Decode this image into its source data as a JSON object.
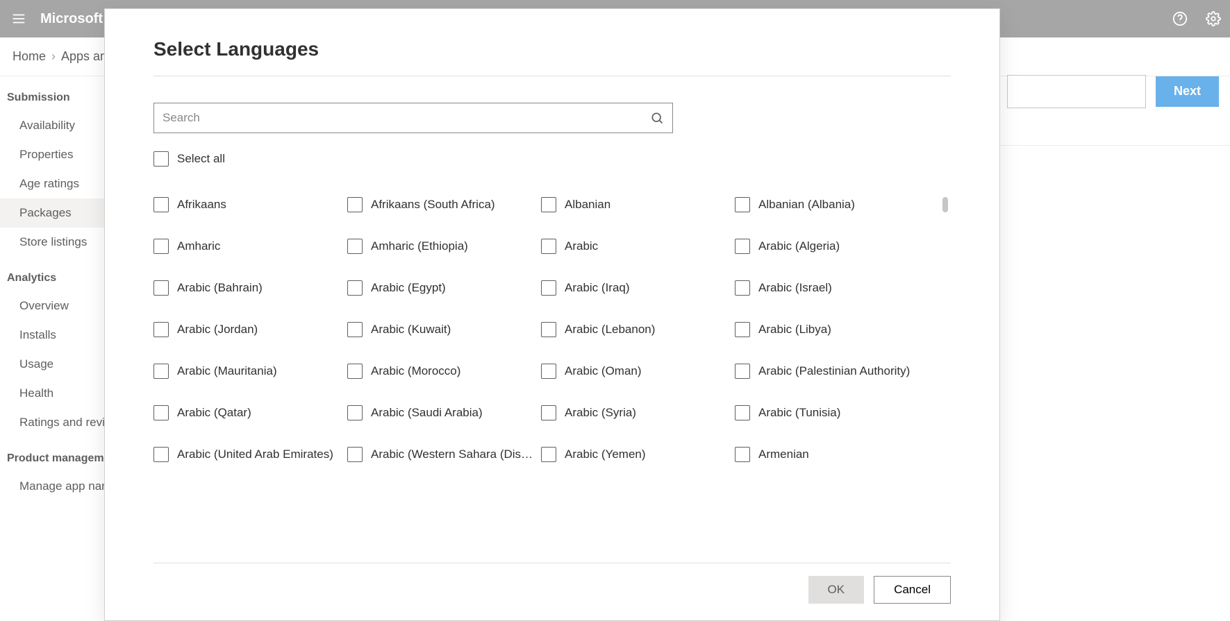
{
  "header": {
    "title": "Microsoft P"
  },
  "breadcrumb": {
    "home": "Home",
    "second": "Apps an"
  },
  "buttons": {
    "next": "Next"
  },
  "sidebar": {
    "groups": [
      {
        "header": "Submission",
        "items": [
          {
            "label": "Availability",
            "active": false
          },
          {
            "label": "Properties",
            "active": false
          },
          {
            "label": "Age ratings",
            "active": false
          },
          {
            "label": "Packages",
            "active": true
          },
          {
            "label": "Store listings",
            "active": false
          }
        ]
      },
      {
        "header": "Analytics",
        "items": [
          {
            "label": "Overview",
            "active": false
          },
          {
            "label": "Installs",
            "active": false
          },
          {
            "label": "Usage",
            "active": false
          },
          {
            "label": "Health",
            "active": false
          },
          {
            "label": "Ratings and revie",
            "active": false
          }
        ]
      },
      {
        "header": "Product management",
        "items": [
          {
            "label": "Manage app nam",
            "active": false
          }
        ]
      }
    ]
  },
  "modal": {
    "title": "Select Languages",
    "search_placeholder": "Search",
    "select_all_label": "Select all",
    "ok_label": "OK",
    "cancel_label": "Cancel",
    "languages": [
      "Afrikaans",
      "Afrikaans (South Africa)",
      "Albanian",
      "Albanian (Albania)",
      "Amharic",
      "Amharic (Ethiopia)",
      "Arabic",
      "Arabic (Algeria)",
      "Arabic (Bahrain)",
      "Arabic (Egypt)",
      "Arabic (Iraq)",
      "Arabic (Israel)",
      "Arabic (Jordan)",
      "Arabic (Kuwait)",
      "Arabic (Lebanon)",
      "Arabic (Libya)",
      "Arabic (Mauritania)",
      "Arabic (Morocco)",
      "Arabic (Oman)",
      "Arabic (Palestinian Authority)",
      "Arabic (Qatar)",
      "Arabic (Saudi Arabia)",
      "Arabic (Syria)",
      "Arabic (Tunisia)",
      "Arabic (United Arab Emirates)",
      "Arabic (Western Sahara (Dispute…",
      "Arabic (Yemen)",
      "Armenian"
    ]
  }
}
